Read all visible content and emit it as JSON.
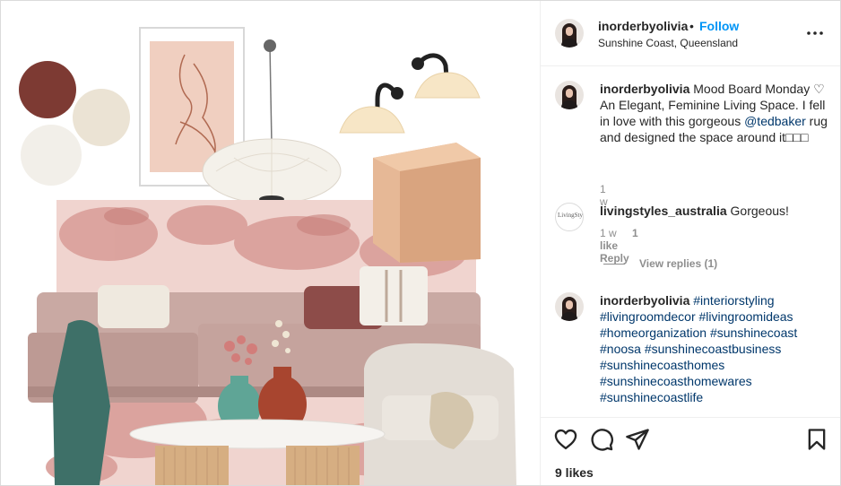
{
  "post": {
    "username": "inorderbyolivia",
    "separator": "•",
    "follow_label": "Follow",
    "location": "Sunshine Coast, Queensland",
    "more_icon": "more-horizontal-icon"
  },
  "comments": [
    {
      "username": "inorderbyolivia",
      "text_parts": [
        "Mood Board Monday ♡ An Elegant, Feminine Living Space. I fell in love with this gorgeous ",
        "@tedbaker",
        " rug and designed the space around it□□□"
      ],
      "time": "1 w"
    },
    {
      "username": "livingstyles_australia",
      "avatar_text": "LivingStyles",
      "text": "Gorgeous!",
      "time": "1 w",
      "likes": "1 like",
      "reply_label": "Reply",
      "view_replies": "View replies (1)"
    },
    {
      "username": "inorderbyolivia",
      "hashtags": [
        "#interiorstyling",
        "#livingroomdecor",
        "#livingroomideas",
        "#homeorganization",
        "#sunshinecoast",
        "#noosa",
        "#sunshinecoastbusiness",
        "#sunshinecoasthomes",
        "#sunshinecoasthomewares",
        "#sunshinecoastlife"
      ]
    }
  ],
  "actions": {
    "like_icon": "heart-icon",
    "comment_icon": "comment-icon",
    "share_icon": "share-icon",
    "save_icon": "bookmark-icon",
    "likes": "9 likes"
  },
  "colors": {
    "link": "#00376b",
    "follow": "#0095f6",
    "swatch_rust": "#8a3b33",
    "swatch_cream": "#ece5d8",
    "rug_pink": "#e9b7b3",
    "sofa": "#c7a9a4"
  }
}
